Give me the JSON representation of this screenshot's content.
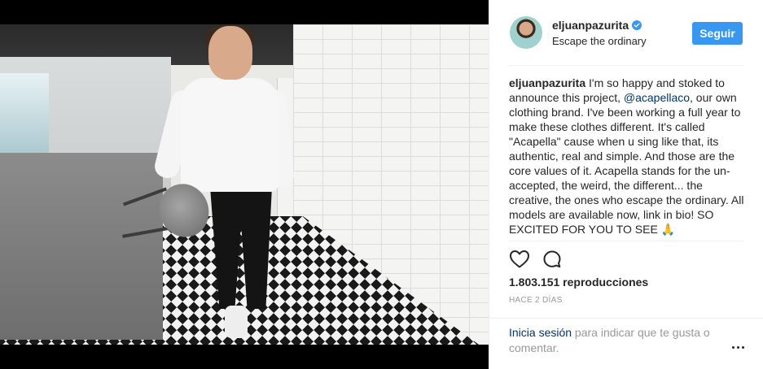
{
  "post": {
    "username": "eljuanpazurita",
    "subtitle": "Escape the ordinary",
    "follow_label": "Seguir",
    "caption_user": "eljuanpazurita",
    "caption_before": " I'm so happy and stoked to announce this project, ",
    "caption_mention": "@acapellaco",
    "caption_after": ", our own clothing brand. I've been working a full year to make these clothes different. It's called \"Acapella\" cause when u sing like that, its authentic, real and simple. And those are the core values of it. Acapella stands for the un-accepted, the weird, the different... the creative, the ones who escape the ordinary. All models are available now, link in bio! SO EXCITED FOR YOU TO SEE 🙏",
    "views": "1.803.151 reproducciones",
    "time": "HACE 2 DÍAS"
  },
  "footer": {
    "login_link": "Inicia sesión",
    "login_text": " para indicar que te gusta o comentar."
  },
  "icons": {
    "like": "heart-icon",
    "comment": "comment-icon",
    "verified": "verified-badge-icon",
    "more": "more-options-icon"
  },
  "colors": {
    "accent": "#3897f0",
    "link": "#003569",
    "muted": "#999999",
    "text": "#262626"
  }
}
